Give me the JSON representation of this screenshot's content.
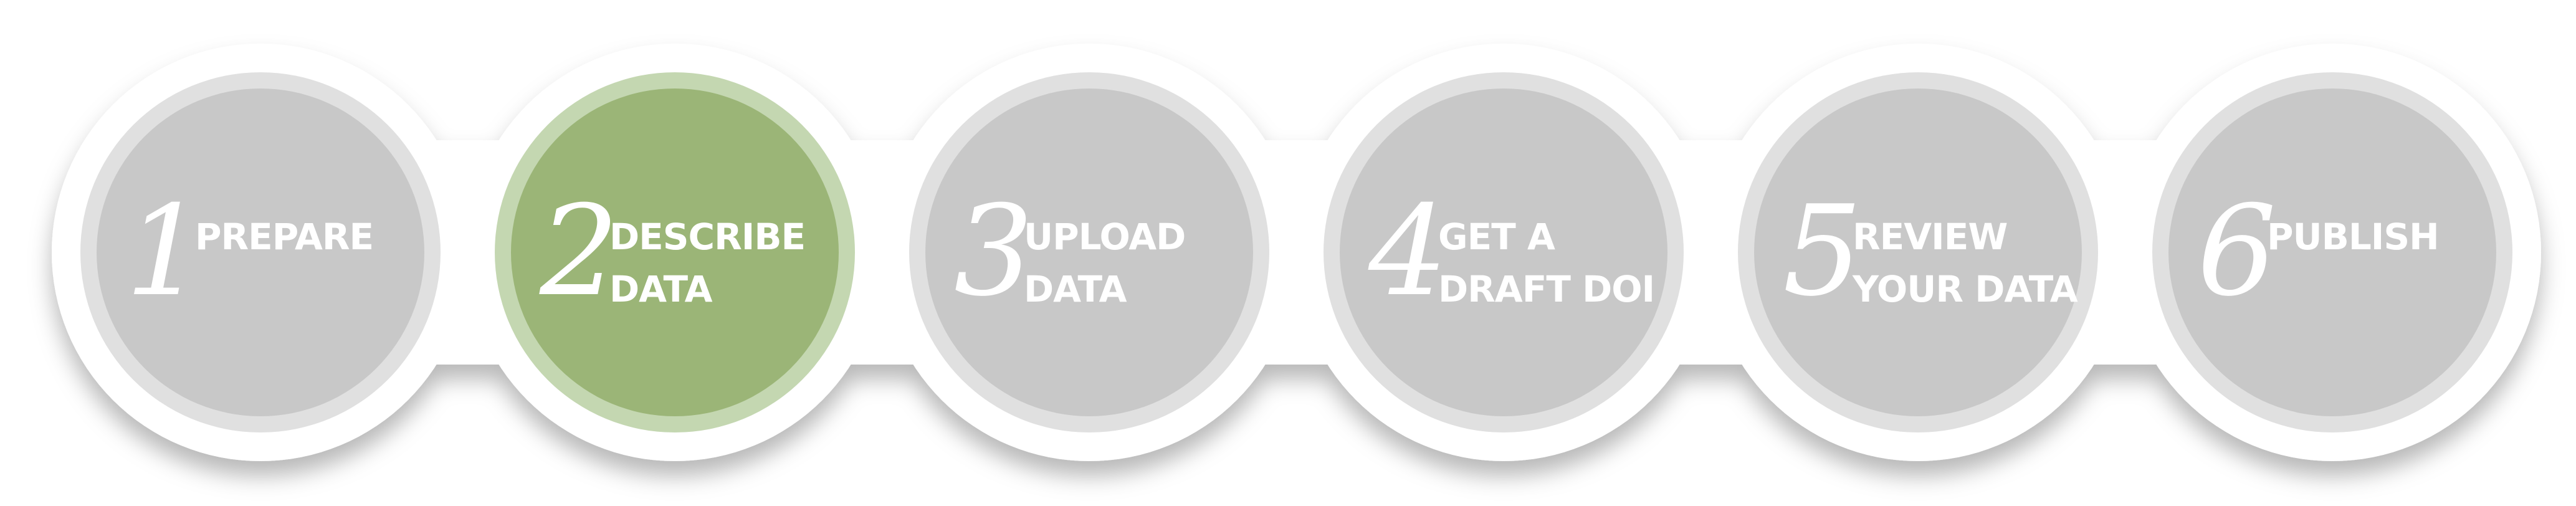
{
  "steps": [
    {
      "number": "1",
      "line1": "PREPARE",
      "line2": "",
      "active": false
    },
    {
      "number": "2",
      "line1": "DESCRIBE",
      "line2": "DATA",
      "active": true
    },
    {
      "number": "3",
      "line1": "UPLOAD",
      "line2": "DATA",
      "active": false
    },
    {
      "number": "4",
      "line1": "GET A",
      "line2": "DRAFT DOI",
      "active": false
    },
    {
      "number": "5",
      "line1": "REVIEW",
      "line2": "YOUR DATA",
      "active": false
    },
    {
      "number": "6",
      "line1": "PUBLISH",
      "line2": "",
      "active": false
    }
  ],
  "colors": {
    "band": "#ffffff",
    "inactive_ring": "#e0e0e0",
    "inactive_disc": "#c8c8c8",
    "active_ring": "#c4d7b1",
    "active_disc": "#9bb577",
    "text": "#ffffff"
  }
}
